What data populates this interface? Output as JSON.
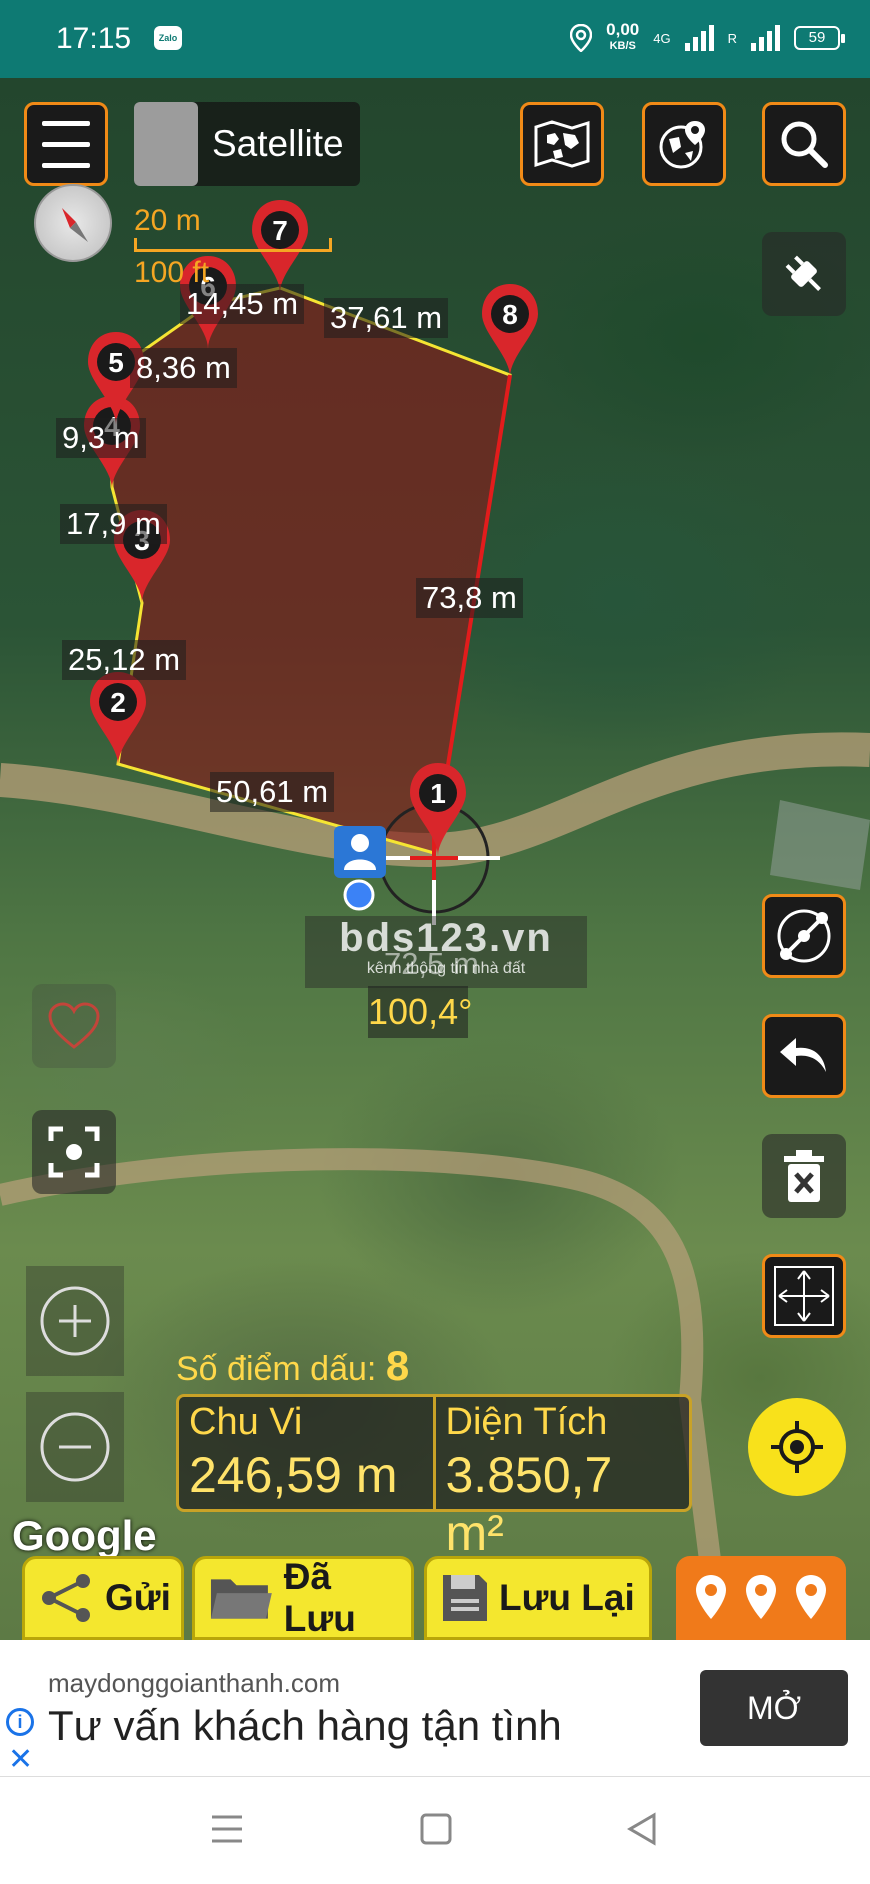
{
  "status_bar": {
    "time": "17:15",
    "notification_app": "Zalo",
    "net_speed": "0,00",
    "net_unit": "KB/S",
    "network_type": "4G",
    "roaming": "R",
    "battery": "59"
  },
  "toolbar": {
    "layer_label": "Satellite",
    "scale_metric": "20 m",
    "scale_imperial": "100 ft"
  },
  "map": {
    "points": [
      "1",
      "2",
      "3",
      "4",
      "5",
      "6",
      "7",
      "8"
    ],
    "segment_labels": {
      "seg_1_2": "50,61 m",
      "seg_2_3": "25,12 m",
      "seg_3_4": "17,9 m",
      "seg_4_5": "9,3 m",
      "seg_5_6": "8,36 m",
      "seg_6_7": "14,45 m",
      "seg_7_8": "37,61 m",
      "seg_8_1": "73,8 m",
      "live_distance": "72,5 m"
    },
    "angle": "100,4°",
    "watermark_title": "bds123.vn",
    "watermark_subtitle": "kênh thông tin nhà đất"
  },
  "measure": {
    "count_label": "Số điểm dấu:",
    "count_value": "8",
    "perimeter_label": "Chu Vi",
    "perimeter_value": "246,59 m",
    "area_label": "Diện Tích",
    "area_value": "3.850,7  m²"
  },
  "actions": {
    "share": "Gửi",
    "saved": "Đã Lưu",
    "save": "Lưu Lại"
  },
  "brand": {
    "map_provider": "Google"
  },
  "ad": {
    "domain": "maydonggoianthanh.com",
    "headline": "Tư vấn khách hàng tận tình",
    "cta": "MỞ"
  },
  "colors": {
    "accent_orange": "#f08a17",
    "polygon_fill": "#8b1a1a",
    "button_yellow": "#f4e72e",
    "status_teal": "#0e7a73"
  }
}
